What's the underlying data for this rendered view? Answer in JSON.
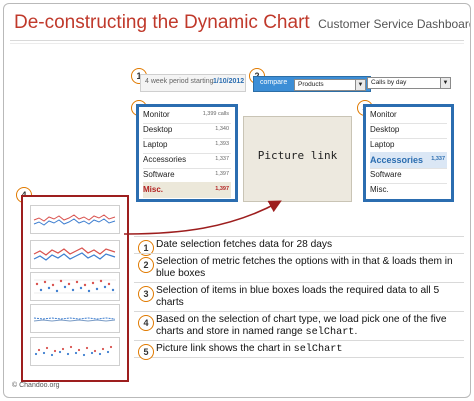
{
  "header": {
    "title": "De-constructing the Dynamic Chart",
    "subtitle": "Customer Service Dashboard"
  },
  "controls": {
    "period_label": "4 week period starting",
    "period_value": "1/10/2012",
    "compare_label": "compare",
    "compare_value": "Products",
    "metric_value": "Calls by day"
  },
  "badges": [
    "1",
    "2",
    "3",
    "4",
    "5"
  ],
  "list": {
    "items": [
      {
        "name": "Monitor",
        "value": "1,399 calls"
      },
      {
        "name": "Desktop",
        "value": "1,340"
      },
      {
        "name": "Laptop",
        "value": "1,393"
      },
      {
        "name": "Accessories",
        "value": "1,337"
      },
      {
        "name": "Software",
        "value": "1,397"
      },
      {
        "name": "Misc.",
        "value": "1,397"
      }
    ],
    "right_values": [
      "",
      "",
      "",
      "1,337",
      "",
      ""
    ]
  },
  "picture_link": {
    "text": "Picture link"
  },
  "steps": [
    {
      "num": "1",
      "text": "Date selection fetches data for 28 days",
      "code": "",
      "after": ""
    },
    {
      "num": "2",
      "text": "Selection of metric fetches the options with in that & loads them in blue boxes",
      "code": "",
      "after": ""
    },
    {
      "num": "3",
      "text": "Selection of items in blue boxes loads the required data to all 5 charts",
      "code": "",
      "after": ""
    },
    {
      "num": "4",
      "text": "Based on the selection of chart type, we load pick one of the five charts and store in named range ",
      "code": "selChart",
      "after": "."
    },
    {
      "num": "5",
      "text": "Picture link shows the chart in ",
      "code": "selChart",
      "after": ""
    }
  ],
  "footer": "© Chandoo.org",
  "colors": {
    "title_red": "#c0392b",
    "blue_box": "#2b6db0",
    "red_box": "#9d1e1e",
    "badge_orange": "#e07a00",
    "series_red": "#d9534f",
    "series_blue": "#3f7fd0"
  }
}
